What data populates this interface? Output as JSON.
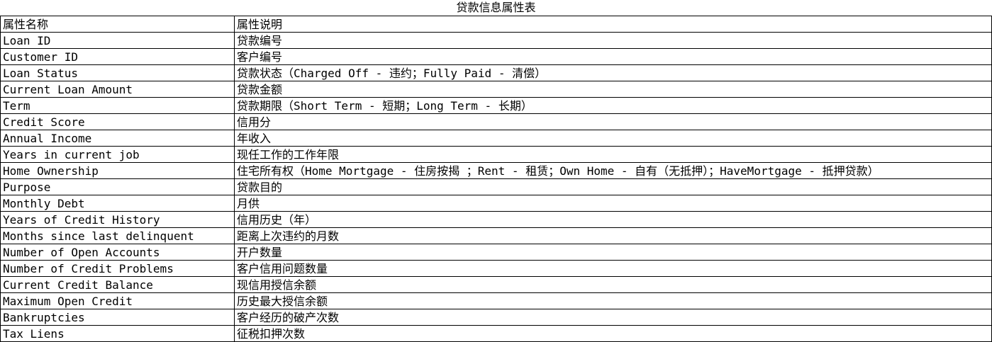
{
  "title": "贷款信息属性表",
  "header": {
    "name": "属性名称",
    "description": "属性说明"
  },
  "rows": [
    {
      "name": "Loan ID",
      "description": "贷款编号"
    },
    {
      "name": "Customer ID",
      "description": "客户编号"
    },
    {
      "name": "Loan Status",
      "description": "贷款状态（Charged Off - 违约；Fully Paid - 清偿）"
    },
    {
      "name": "Current Loan Amount",
      "description": "贷款金额"
    },
    {
      "name": "Term",
      "description": "贷款期限（Short Term - 短期；Long Term - 长期）"
    },
    {
      "name": "Credit Score",
      "description": "信用分"
    },
    {
      "name": "Annual Income",
      "description": "年收入"
    },
    {
      "name": "Years in current job",
      "description": "现任工作的工作年限"
    },
    {
      "name": "Home Ownership",
      "description": "住宅所有权（Home Mortgage - 住房按揭 ；Rent - 租赁；Own Home - 自有（无抵押）；HaveMortgage - 抵押贷款）"
    },
    {
      "name": "Purpose",
      "description": "贷款目的"
    },
    {
      "name": "Monthly Debt",
      "description": "月供"
    },
    {
      "name": "Years of Credit History",
      "description": "信用历史（年）"
    },
    {
      "name": "Months since last delinquent",
      "description": "距离上次违约的月数"
    },
    {
      "name": "Number of Open Accounts",
      "description": "开户数量"
    },
    {
      "name": "Number of Credit Problems",
      "description": "客户信用问题数量"
    },
    {
      "name": "Current Credit Balance",
      "description": "现信用授信余额"
    },
    {
      "name": "Maximum Open Credit",
      "description": "历史最大授信余额"
    },
    {
      "name": "Bankruptcies",
      "description": "客户经历的破产次数"
    },
    {
      "name": "Tax Liens",
      "description": "征税扣押次数"
    }
  ]
}
